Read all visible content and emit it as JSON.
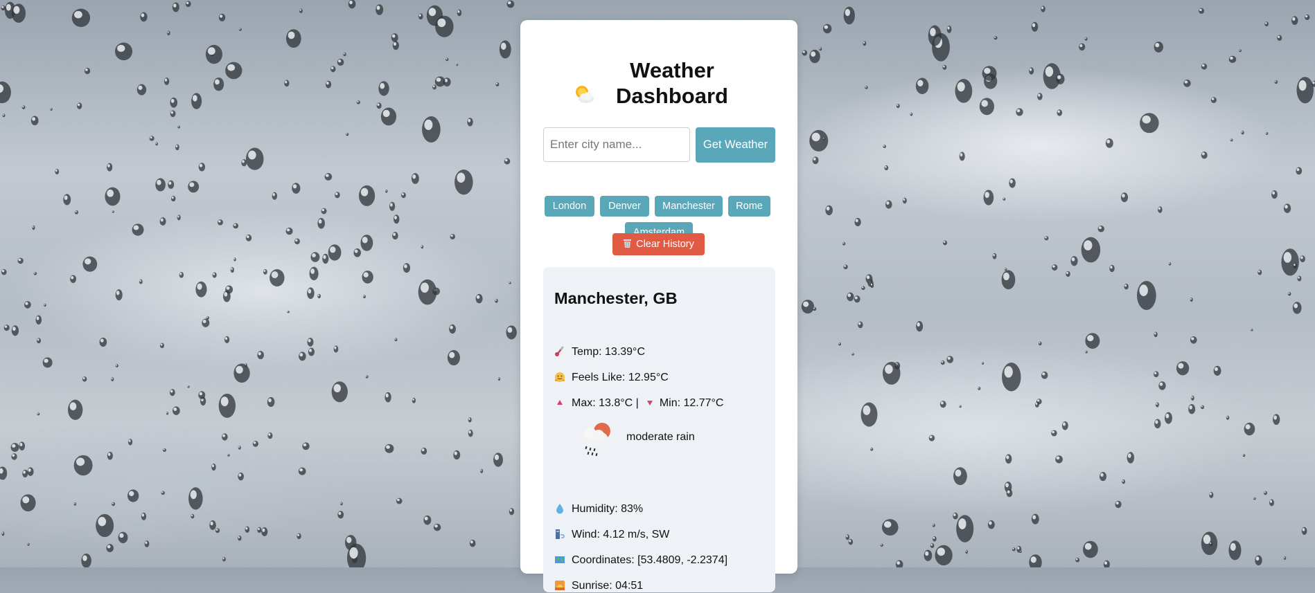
{
  "header": {
    "title": "Weather Dashboard",
    "title_icon": "sun-behind-cloud-icon"
  },
  "search": {
    "placeholder": "Enter city name...",
    "value": "",
    "button_label": "Get Weather"
  },
  "history": {
    "items": [
      "London",
      "Denver",
      "Manchester",
      "Rome",
      "Amsterdam"
    ],
    "clear_label": "Clear History",
    "clear_icon": "wastebasket-icon"
  },
  "weather": {
    "location": "Manchester, GB",
    "temp": "Temp: 13.39°C",
    "feels_like": "Feels Like: 12.95°C",
    "max": "Max: 13.8°C |",
    "min": "Min: 12.77°C",
    "description": "moderate rain",
    "description_icon": "moderate-rain-icon",
    "humidity": "Humidity: 83%",
    "wind": "Wind: 4.12 m/s, SW",
    "coordinates": "Coordinates: [53.4809, -2.2374]",
    "sunrise": "Sunrise: 04:51"
  },
  "colors": {
    "accent": "#5aa7b9",
    "danger": "#e05a44",
    "panel": "#eef1f5",
    "card": "#ffffff"
  }
}
